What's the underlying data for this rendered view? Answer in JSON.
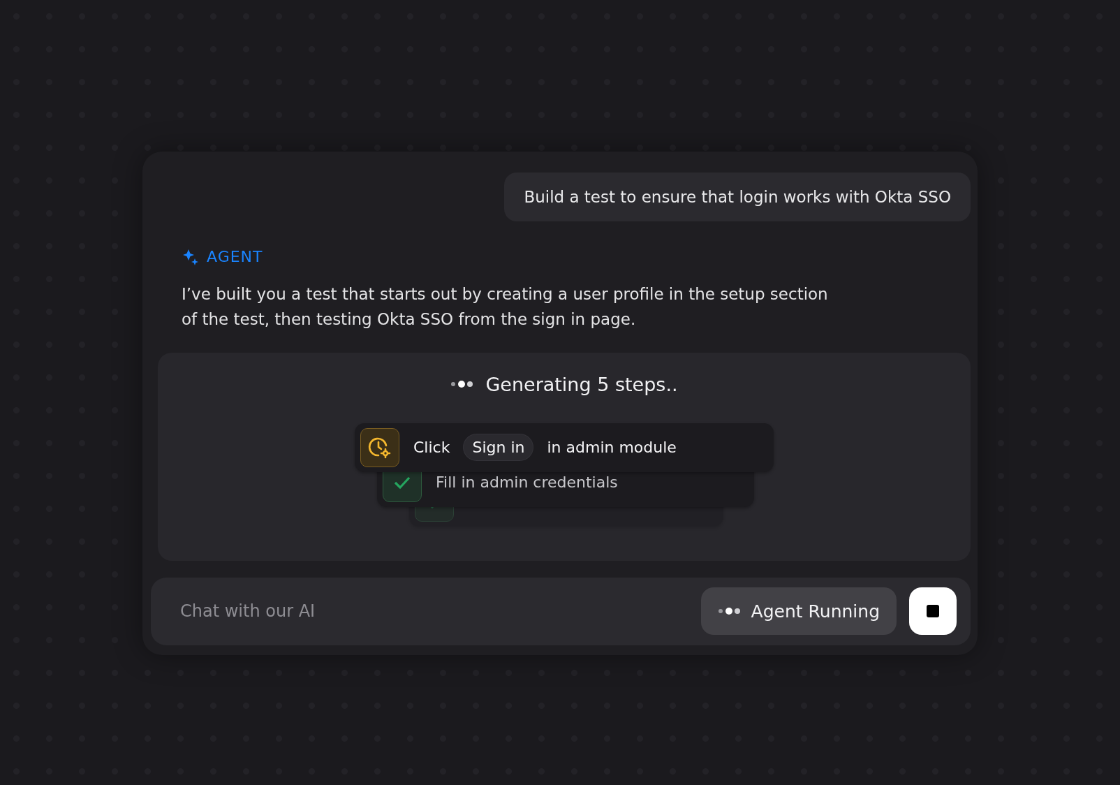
{
  "user_message": "Build a test to ensure that login works with Okta SSO",
  "agent": {
    "label": "AGENT",
    "message": "I’ve built you a test that starts out by creating a user profile in the setup section of the test, then testing Okta SSO from the sign in page."
  },
  "generation": {
    "status": "Generating 5 steps..",
    "steps": [
      {
        "kind": "current",
        "before": "Click",
        "chip": "Sign in",
        "after": "in admin module"
      },
      {
        "kind": "done",
        "text": "Fill in admin credentials"
      },
      {
        "kind": "done"
      }
    ]
  },
  "chat": {
    "placeholder": "Chat with our AI",
    "status": "Agent Running"
  }
}
